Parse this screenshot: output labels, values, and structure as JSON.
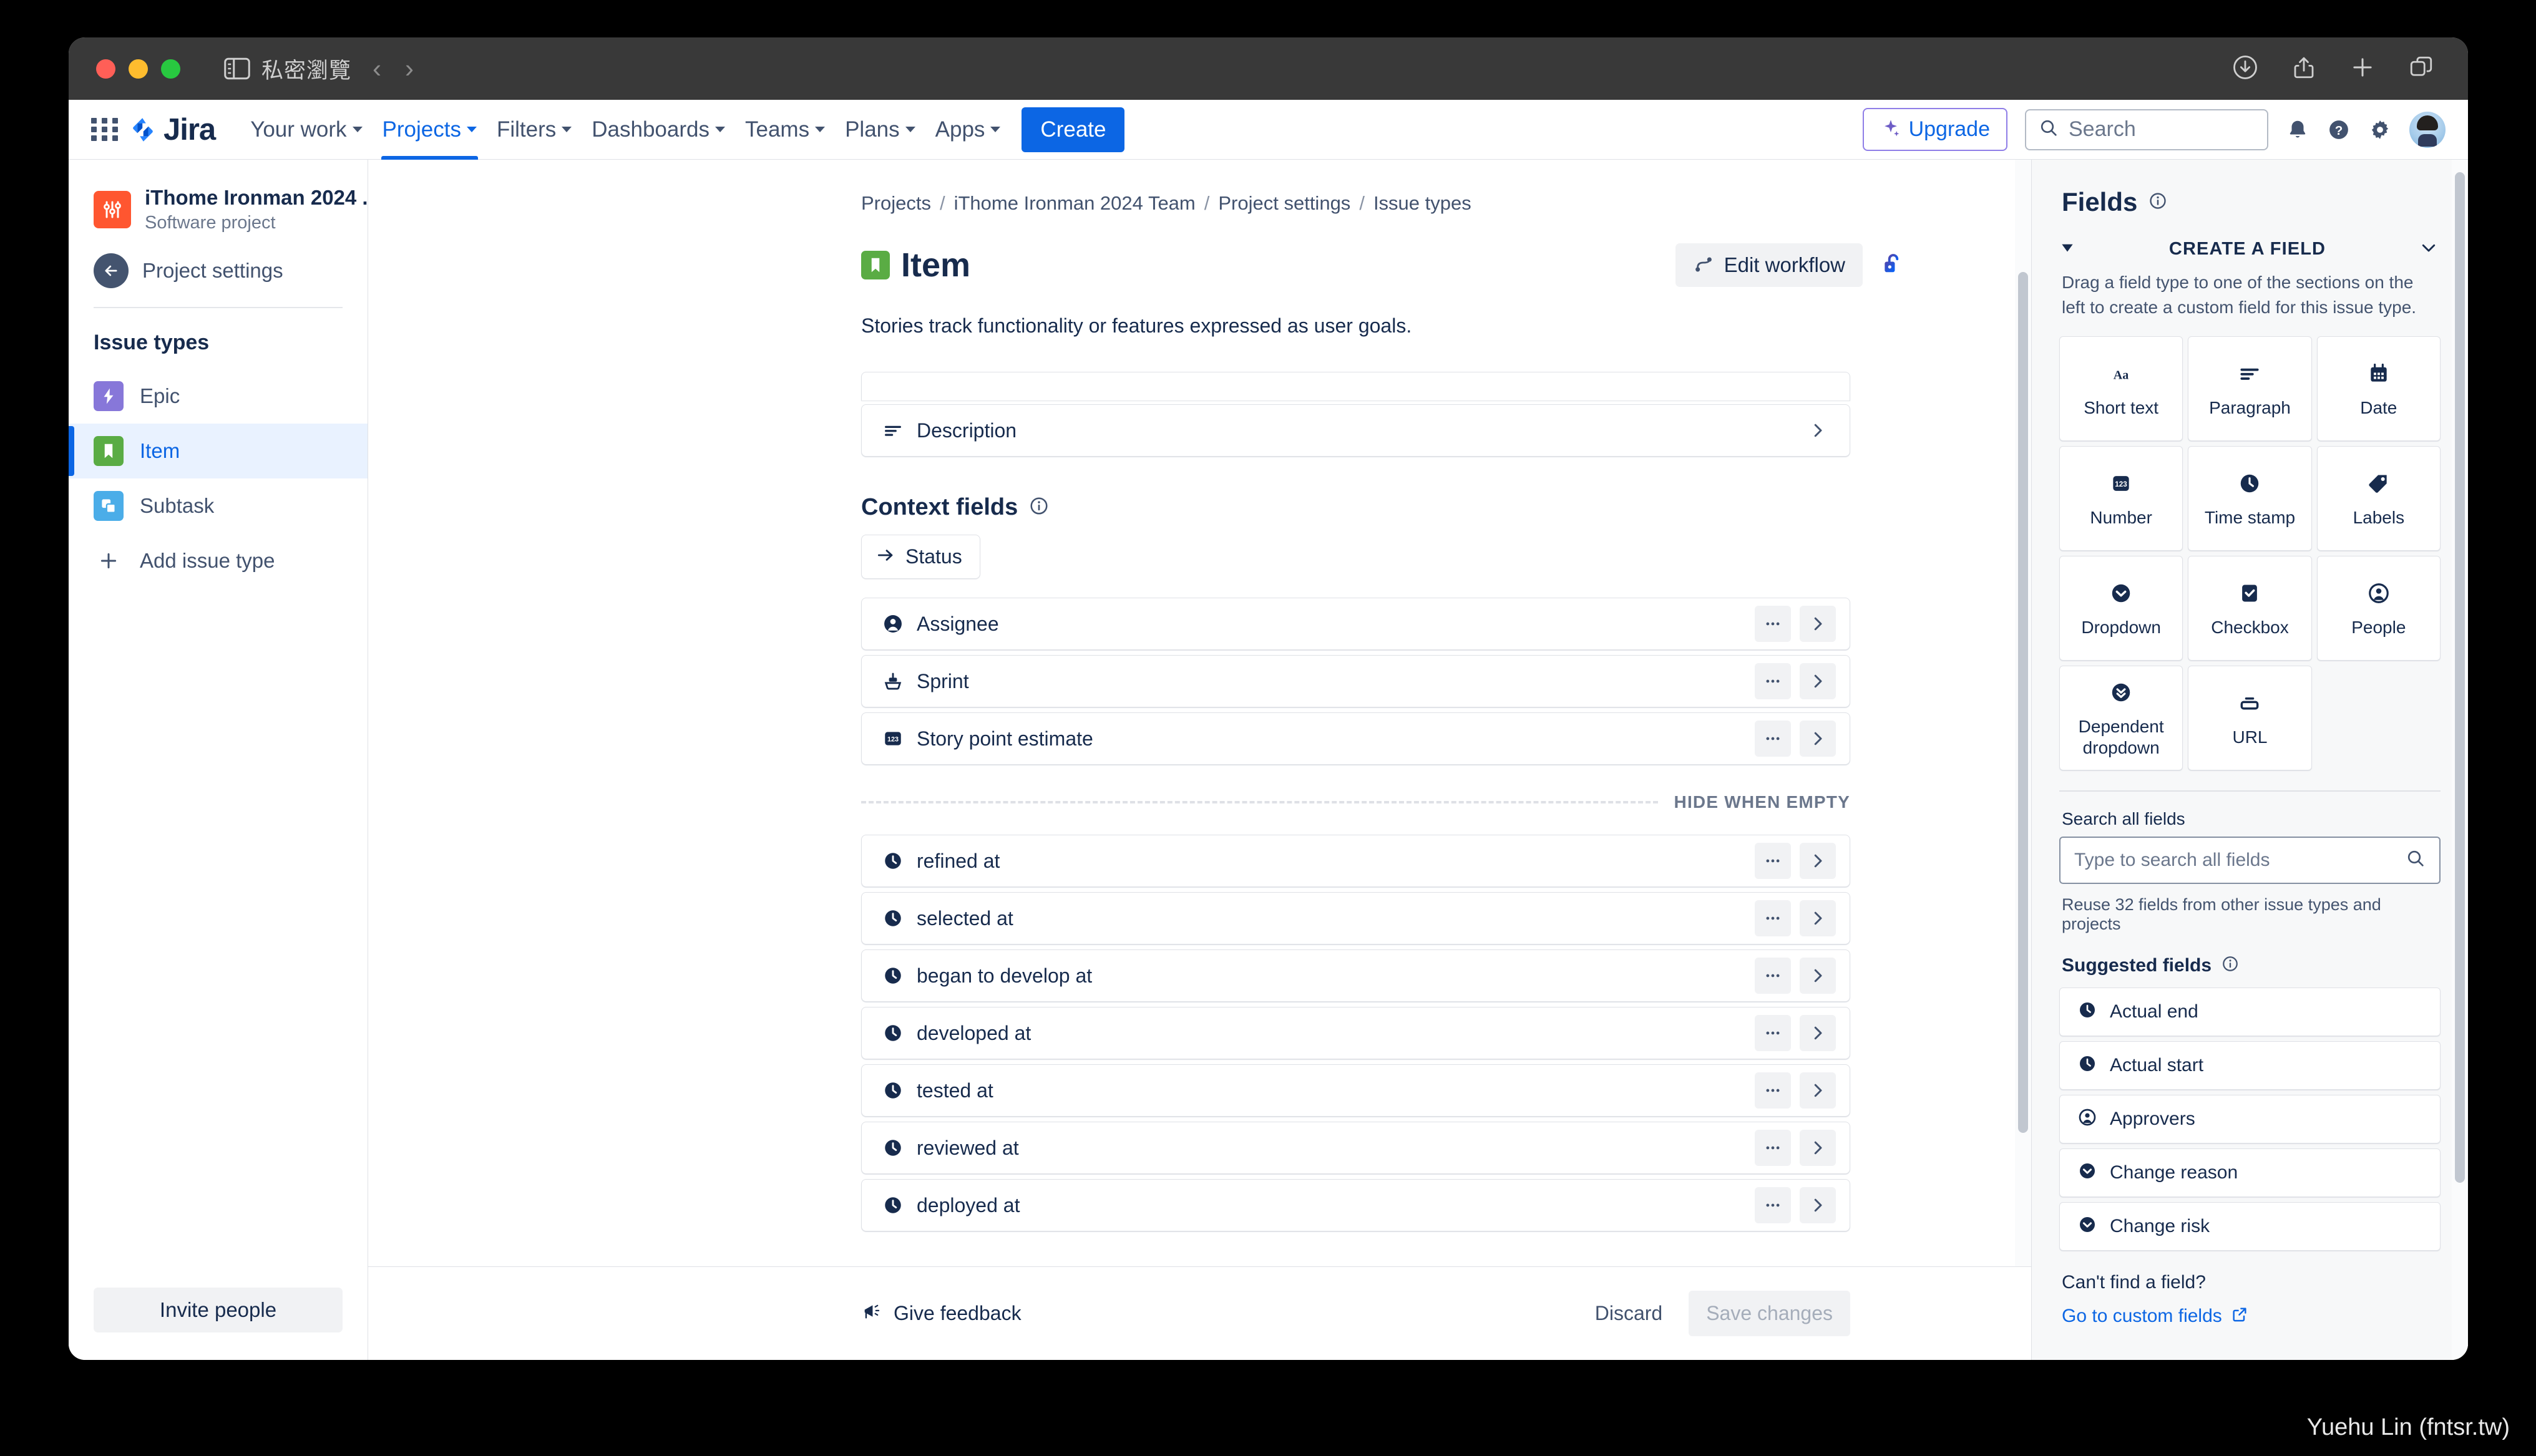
{
  "browser": {
    "private_label": "私密瀏覽",
    "back_arrow": "‹",
    "forward_arrow": "›"
  },
  "nav": {
    "logo_text": "Jira",
    "items": [
      {
        "label": "Your work",
        "has_caret": true,
        "active": false
      },
      {
        "label": "Projects",
        "has_caret": true,
        "active": true
      },
      {
        "label": "Filters",
        "has_caret": true,
        "active": false
      },
      {
        "label": "Dashboards",
        "has_caret": true,
        "active": false
      },
      {
        "label": "Teams",
        "has_caret": true,
        "active": false
      },
      {
        "label": "Plans",
        "has_caret": true,
        "active": false
      },
      {
        "label": "Apps",
        "has_caret": true,
        "active": false
      }
    ],
    "create_label": "Create",
    "upgrade_label": "Upgrade",
    "search_placeholder": "Search",
    "accent_blue": "#0c66e4",
    "upgrade_purple": "#8f7ee7"
  },
  "sidebar": {
    "project_name": "iThome Ironman 2024 ...",
    "project_type": "Software project",
    "project_settings_label": "Project settings",
    "issue_types_title": "Issue types",
    "issue_types": [
      {
        "label": "Epic",
        "color": "#8777d9",
        "icon": "epic-icon",
        "selected": false
      },
      {
        "label": "Item",
        "color": "#4bade8",
        "icon": "story-icon",
        "selected": true
      },
      {
        "label": "Subtask",
        "color": "#4bade8",
        "icon": "subtask-icon",
        "selected": false
      }
    ],
    "add_issue_type_label": "Add issue type",
    "invite_people_label": "Invite people"
  },
  "main": {
    "breadcrumb": [
      "Projects",
      "iThome Ironman 2024 Team",
      "Project settings",
      "Issue types"
    ],
    "title": "Item",
    "description": "Stories track functionality or features expressed as user goals.",
    "edit_workflow_label": "Edit workflow",
    "description_field_label": "Description",
    "context_fields_title": "Context fields",
    "status_chip_label": "Status",
    "context_fields": [
      {
        "label": "Assignee",
        "icon": "person-icon"
      },
      {
        "label": "Sprint",
        "icon": "sprint-icon"
      },
      {
        "label": "Story point estimate",
        "icon": "number-123-icon"
      }
    ],
    "hide_when_empty_label": "HIDE WHEN EMPTY",
    "hidden_fields": [
      {
        "label": "refined at",
        "icon": "clock-icon"
      },
      {
        "label": "selected at",
        "icon": "clock-icon"
      },
      {
        "label": "began to develop at",
        "icon": "clock-icon"
      },
      {
        "label": "developed at",
        "icon": "clock-icon"
      },
      {
        "label": "tested at",
        "icon": "clock-icon"
      },
      {
        "label": "reviewed at",
        "icon": "clock-icon"
      },
      {
        "label": "deployed at",
        "icon": "clock-icon"
      }
    ],
    "give_feedback_label": "Give feedback",
    "discard_label": "Discard",
    "save_changes_label": "Save changes"
  },
  "right_panel": {
    "title": "Fields",
    "create_a_field_label": "CREATE A FIELD",
    "create_help": "Drag a field type to one of the sections on the left to create a custom field for this issue type.",
    "field_types": [
      {
        "label": "Short text",
        "icon": "short-text-icon"
      },
      {
        "label": "Paragraph",
        "icon": "paragraph-icon"
      },
      {
        "label": "Date",
        "icon": "calendar-icon"
      },
      {
        "label": "Number",
        "icon": "number-123-icon"
      },
      {
        "label": "Time stamp",
        "icon": "clock-icon"
      },
      {
        "label": "Labels",
        "icon": "label-tag-icon"
      },
      {
        "label": "Dropdown",
        "icon": "dropdown-icon"
      },
      {
        "label": "Checkbox",
        "icon": "checkbox-icon"
      },
      {
        "label": "People",
        "icon": "person-icon"
      },
      {
        "label": "Dependent dropdown",
        "icon": "dependent-dropdown-icon"
      },
      {
        "label": "URL",
        "icon": "url-icon"
      }
    ],
    "search_fields_label": "Search all fields",
    "search_fields_placeholder": "Type to search all fields",
    "reuse_note": "Reuse 32 fields from other issue types and projects",
    "suggested_fields_title": "Suggested fields",
    "suggested_fields": [
      {
        "label": "Actual end",
        "icon": "clock-icon"
      },
      {
        "label": "Actual start",
        "icon": "clock-icon"
      },
      {
        "label": "Approvers",
        "icon": "person-icon"
      },
      {
        "label": "Change reason",
        "icon": "dropdown-icon"
      },
      {
        "label": "Change risk",
        "icon": "dropdown-icon"
      }
    ],
    "cant_find_label": "Can't find a field?",
    "go_to_custom_fields_label": "Go to custom fields"
  },
  "watermark": "Yuehu Lin (fntsr.tw)"
}
